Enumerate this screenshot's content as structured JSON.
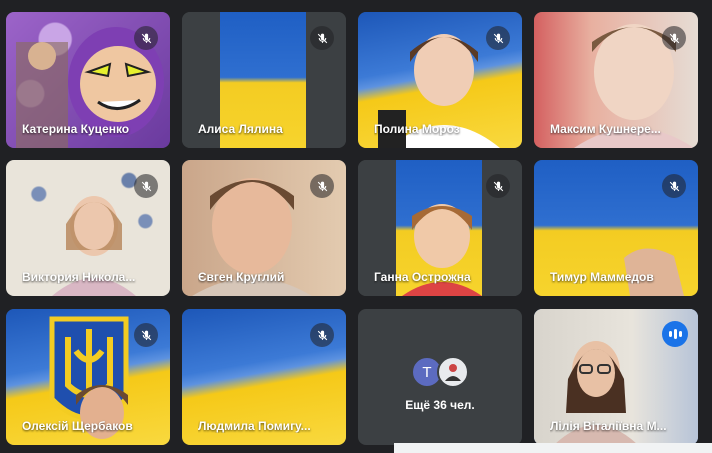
{
  "participants": [
    {
      "name": "Катерина Куценко",
      "muted": true
    },
    {
      "name": "Алиса Лялина",
      "muted": true
    },
    {
      "name": "Полина Мороз",
      "muted": true
    },
    {
      "name": "Максим Кушнере...",
      "muted": true
    },
    {
      "name": "Виктория Никола...",
      "muted": true
    },
    {
      "name": "Євген Круглий",
      "muted": true
    },
    {
      "name": "Ганна Острожна",
      "muted": true
    },
    {
      "name": "Тимур Маммедов",
      "muted": true
    },
    {
      "name": "Олексій Щербаков",
      "muted": true
    },
    {
      "name": "Людмила Помигу...",
      "muted": true
    },
    {
      "name": "Лілія Віталіївна М...",
      "muted": false,
      "speaking": true
    }
  ],
  "more": {
    "avatar_letter": "T",
    "label": "Ещё 36 чел."
  },
  "colors": {
    "background": "#202124",
    "tile": "#3c4043",
    "accent": "#1a73e8",
    "ua_blue": "#1f5fc4",
    "ua_yellow": "#f3cc22"
  }
}
